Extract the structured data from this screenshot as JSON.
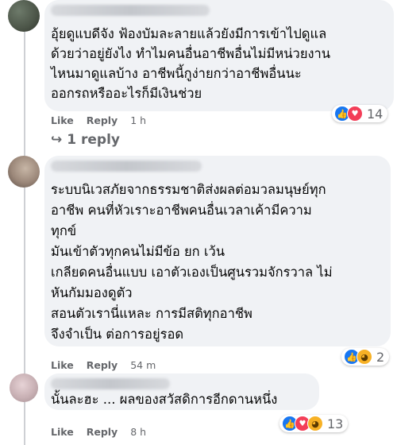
{
  "comments": [
    {
      "name_redacted": true,
      "lines": [
        "อุ้ยดูแบดีจัง ฟ้องบัมละลายแล้วยังมีการเข้าไปดูแล",
        "ด้วยว่าอยู่ยังไง ทำไมคนอื่นอาชีพอื่นไม่มีหน่วยงาน",
        "ไหนมาดูแลบ้าง อาชีพนี้กูง่ายกว่าอาชีพอื่นนะ",
        "ออกรถหรืออะไรก็มีเงินช่วย"
      ],
      "like_label": "Like",
      "reply_label": "Reply",
      "time": "1 h",
      "reaction_icons": [
        "like-icon",
        "love-icon"
      ],
      "reaction_count": "14",
      "replies_label": "1 reply"
    },
    {
      "name_redacted": true,
      "lines": [
        "ระบบนิเวสภัยจากธรรมชาติส่งผลต่อมวลมนุษย์ทุก",
        "อาชีพ คนที่หัวเราะอาชีพคนอื่นเวลาเค้ามีความ",
        "ทุกข์",
        "มันเข้าตัวทุกคนไม่มีข้อ ยก เว้น",
        "เกลียดคนอื่นแบบ เอาตัวเองเป็นศูนรวมจักรวาล ไม่",
        "หันกัมมองดูตัว",
        "สอนตัวเรานี่แหละ การมีสติทุกอาชีพ",
        "จึงจำเป็น ต่อการอยู่รอด"
      ],
      "like_label": "Like",
      "reply_label": "Reply",
      "time": "54 m",
      "reaction_icons": [
        "like-icon",
        "haha-icon"
      ],
      "reaction_count": "2"
    },
    {
      "name_redacted": true,
      "lines": [
        "นั้นละฮะ ... ผลของสวัสดิการอีกดานหนึ่ง"
      ],
      "like_label": "Like",
      "reply_label": "Reply",
      "time": "8 h",
      "reaction_icons": [
        "like-icon",
        "love-icon",
        "haha-icon"
      ],
      "reaction_count": "13"
    }
  ],
  "colors": {
    "bubble": "#f0f2f5",
    "meta_text": "#65676b",
    "like_blue": "#1877f2",
    "love_red": "#f33e58",
    "haha_yellow": "#f7b125"
  }
}
